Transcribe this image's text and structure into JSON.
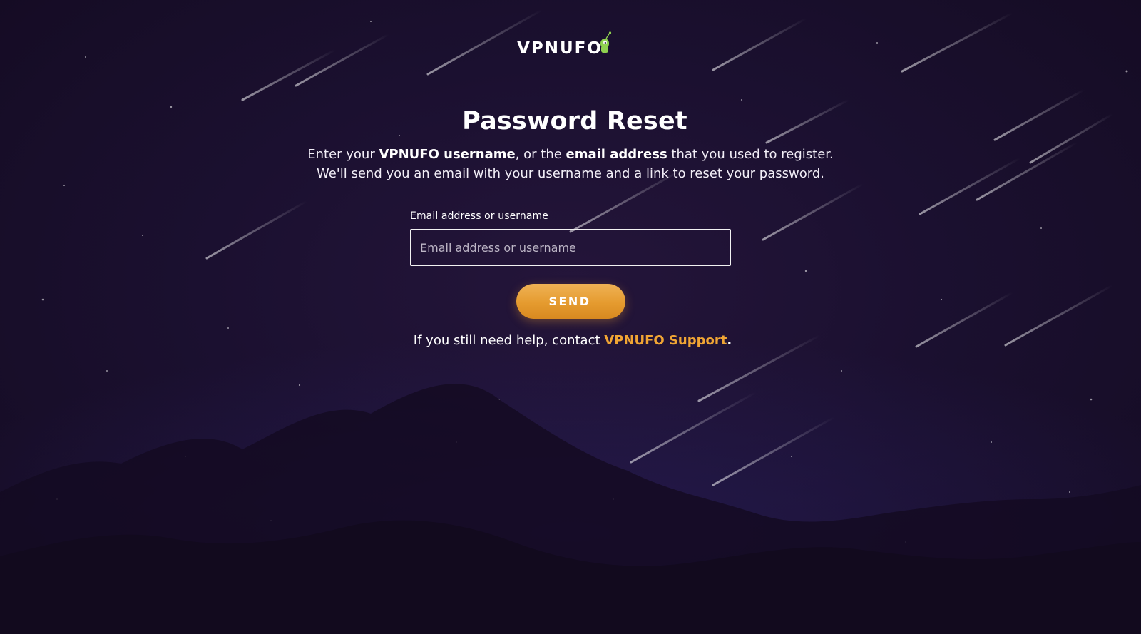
{
  "logo": {
    "text": "VPNUFO",
    "mascot_icon": "alien-icon",
    "mascot_color": "#8fd14f"
  },
  "page": {
    "title": "Password Reset",
    "intro": {
      "part1": "Enter your ",
      "bold1": "VPNUFO username",
      "part2": ", or the ",
      "bold2": "email address",
      "part3": " that you used to register. We'll send you an email with your username and a link to reset your password."
    }
  },
  "form": {
    "label": "Email address or username",
    "placeholder": "Email address or username",
    "value": "",
    "submit_label": "SEND"
  },
  "help": {
    "prefix": "If you still need help, contact ",
    "link_text": "VPNUFO Support",
    "suffix": "."
  },
  "colors": {
    "background": "#1b1030",
    "accent": "#e59b2f",
    "link": "#f0a534",
    "text": "#ffffff"
  }
}
